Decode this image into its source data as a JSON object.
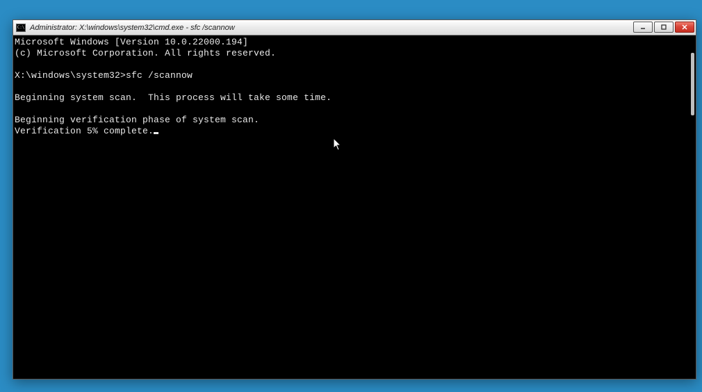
{
  "window": {
    "title": "Administrator: X:\\windows\\system32\\cmd.exe - sfc  /scannow"
  },
  "console": {
    "line1": "Microsoft Windows [Version 10.0.22000.194]",
    "line2": "(c) Microsoft Corporation. All rights reserved.",
    "blank1": "",
    "prompt": "X:\\windows\\system32>",
    "command": "sfc /scannow",
    "blank2": "",
    "line3": "Beginning system scan.  This process will take some time.",
    "blank3": "",
    "line4": "Beginning verification phase of system scan.",
    "line5": "Verification 5% complete."
  }
}
